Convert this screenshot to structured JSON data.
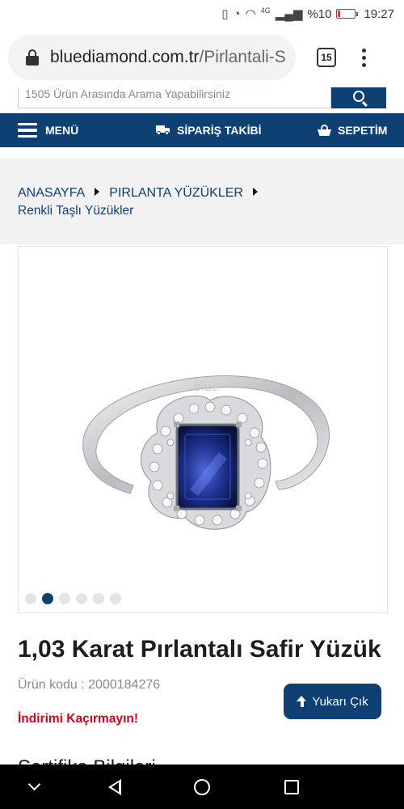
{
  "status_bar": {
    "battery_text": "%10",
    "time": "19:27",
    "network": "4G",
    "icons": [
      "vibrate-icon",
      "alarm-icon",
      "wifi-icon",
      "signal-icon",
      "battery-icon"
    ]
  },
  "browser": {
    "url_host": "bluediamond.com.tr",
    "url_path": "/Pirlantali-S",
    "tab_count": "15"
  },
  "search": {
    "placeholder": "1505 Ürün Arasında Arama Yapabilirsiniz"
  },
  "nav": {
    "menu_label": "MENÜ",
    "order_tracking_label": "SİPARİŞ TAKİBİ",
    "cart_label": "SEPETİM"
  },
  "breadcrumb": {
    "items": [
      "ANASAYFA",
      "PIRLANTA YÜZÜKLER",
      "Renkli Taşlı Yüzükler"
    ]
  },
  "gallery": {
    "total_images": 6,
    "active_index": 1,
    "watermark": "blue"
  },
  "product": {
    "title": "1,03 Karat Pırlantalı Safir Yüzük",
    "code": "Ürün kodu : 2000184276",
    "promo": "İndirimi Kaçırmayın!",
    "next_heading": "Sertifika Bilgileri"
  },
  "scroll_top_button": {
    "label": "Yukarı Çık"
  },
  "colors": {
    "brand_navy": "#0f4073",
    "promo_red": "#d0021b",
    "sapphire": "#1c2f8c"
  }
}
